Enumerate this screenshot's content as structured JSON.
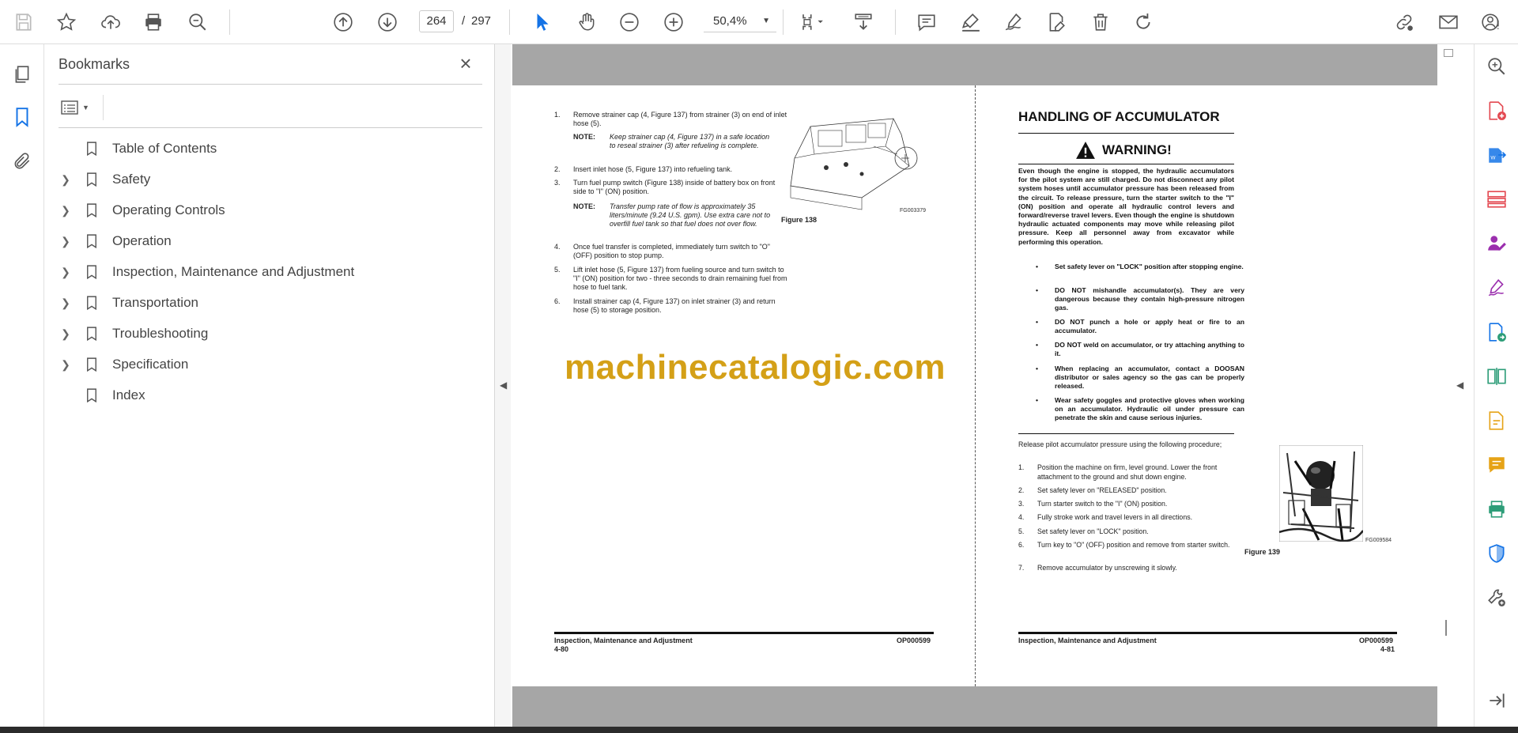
{
  "toolbar": {
    "current_page": "264",
    "page_separator": "/",
    "total_pages": "297",
    "zoom": "50,4%",
    "icons": [
      "save-icon",
      "star-icon",
      "cloud-upload-icon",
      "print-icon",
      "search-icon",
      "page-up-icon",
      "page-down-icon",
      "select-cursor-icon",
      "hand-icon",
      "zoom-out-icon",
      "zoom-in-icon",
      "page-fit-icon",
      "scroll-mode-icon",
      "comment-icon",
      "highlight-icon",
      "sign-icon",
      "fill-sign-icon",
      "delete-icon",
      "rotate-icon",
      "share-link-icon",
      "email-icon",
      "account-icon"
    ]
  },
  "bookmarks": {
    "title": "Bookmarks",
    "items": [
      {
        "label": "Table of Contents",
        "expandable": false
      },
      {
        "label": "Safety",
        "expandable": true
      },
      {
        "label": "Operating Controls",
        "expandable": true
      },
      {
        "label": "Operation",
        "expandable": true
      },
      {
        "label": "Inspection, Maintenance and Adjustment",
        "expandable": true
      },
      {
        "label": "Transportation",
        "expandable": true
      },
      {
        "label": "Troubleshooting",
        "expandable": true
      },
      {
        "label": "Specification",
        "expandable": true
      },
      {
        "label": "Index",
        "expandable": false
      }
    ]
  },
  "doc": {
    "watermark": "machinecatalogic.com",
    "left": {
      "step1_n": "1.",
      "step1": "Remove strainer cap (4, Figure 137) from strainer (3) on end of inlet hose (5).",
      "note1_k": "NOTE:",
      "note1": "Keep strainer cap (4, Figure 137) in a safe location to reseal strainer (3) after refueling is complete.",
      "step2_n": "2.",
      "step2": "Insert inlet hose (5, Figure 137) into refueling tank.",
      "step3_n": "3.",
      "step3": "Turn fuel pump switch (Figure 138) inside of battery box on front side to \"I\" (ON) position.",
      "note2_k": "NOTE:",
      "note2": "Transfer pump rate of flow is approximately 35 liters/minute (9.24 U.S. gpm). Use extra care not to overfill fuel tank so that fuel does not over flow.",
      "step4_n": "4.",
      "step4": "Once fuel transfer is completed, immediately turn switch to \"O\" (OFF) position to stop pump.",
      "step5_n": "5.",
      "step5": "Lift inlet hose (5, Figure 137) from fueling source and turn switch to \"I\" (ON) position for two - three seconds to drain remaining fuel from hose to fuel tank.",
      "step6_n": "6.",
      "step6": "Install strainer cap (4, Figure 137) on inlet strainer (3) and return hose (5) to storage position.",
      "fig_code": "FG003379",
      "fig_caption": "Figure 138",
      "footer_section": "Inspection, Maintenance and Adjustment",
      "footer_page": "4-80",
      "footer_code": "OP000599"
    },
    "right": {
      "heading": "HANDLING OF ACCUMULATOR",
      "warning_title": "WARNING!",
      "warning_body": "Even though the engine is stopped, the hydraulic accumulators for the pilot system are still charged. Do not disconnect any pilot system hoses until accumulator pressure has been released from the circuit. To release pressure, turn the starter switch to the \"I\" (ON) position and operate all hydraulic control levers and forward/reverse travel levers. Even though the engine is shutdown hydraulic actuated components may move while releasing pilot pressure. Keep all personnel away from excavator while performing this operation.",
      "bullet_mark": "•",
      "bullet1": "Set safety lever on \"LOCK\" position after stopping engine.",
      "bullet2": "DO NOT mishandle accumulator(s). They are very dangerous because they contain high-pressure nitrogen gas.",
      "bullet3": "DO NOT punch a hole or apply heat or fire to an accumulator.",
      "bullet4": "DO NOT weld on accumulator, or try attaching anything to it.",
      "bullet5": "When replacing an accumulator, contact a DOOSAN distributor or sales agency so the gas can be properly released.",
      "bullet6": "Wear safety goggles and protective gloves when working on an accumulator. Hydraulic oil under pressure can penetrate the skin and cause serious injuries.",
      "intro": "Release pilot accumulator pressure using the following procedure;",
      "s1_n": "1.",
      "s1": "Position the machine on firm, level ground. Lower the front attachment to the ground and shut down engine.",
      "s2_n": "2.",
      "s2": "Set safety lever on \"RELEASED\" position.",
      "s3_n": "3.",
      "s3": "Turn starter switch to the \"I\" (ON) position.",
      "s4_n": "4.",
      "s4": "Fully stroke work and travel levers in all directions.",
      "s5_n": "5.",
      "s5": "Set safety lever on \"LOCK\" position.",
      "s6_n": "6.",
      "s6": "Turn key to \"O\" (OFF) position and remove from starter switch.",
      "s7_n": "7.",
      "s7": "Remove accumulator by unscrewing it slowly.",
      "fig_code": "FG009584",
      "fig_caption": "Figure 139",
      "footer_section": "Inspection, Maintenance and Adjustment",
      "footer_page": "4-81",
      "footer_code": "OP000599"
    }
  },
  "colors": {
    "accent_blue": "#1473e6",
    "watermark": "#d4a017",
    "doc_gray": "#a6a6a6"
  }
}
